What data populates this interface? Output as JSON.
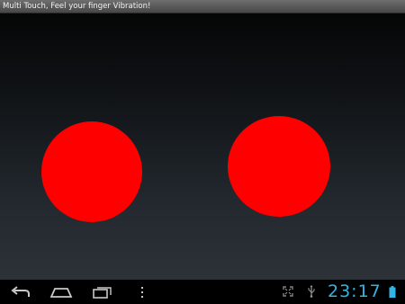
{
  "app": {
    "title": "Multi Touch, Feel your finger Vibration!"
  },
  "canvas": {
    "touch_point_color": "#ff0000",
    "touch_points_count": 2
  },
  "system_bar": {
    "nav_buttons": [
      "back-icon",
      "home-icon",
      "recent-apps-icon",
      "menu-icon"
    ],
    "status_icons": [
      "screen-compatibility-icon",
      "usb-icon",
      "battery-icon"
    ],
    "clock": "23:17",
    "accent_color": "#32b5e5"
  }
}
